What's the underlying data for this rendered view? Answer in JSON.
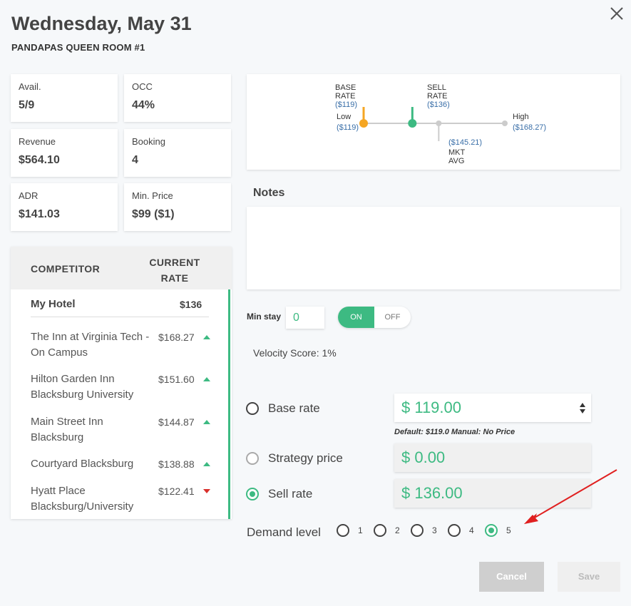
{
  "header": {
    "title": "Wednesday, May 31",
    "subtitle": "PANDAPAS QUEEN ROOM #1"
  },
  "stats": [
    {
      "label": "Avail.",
      "value": "5/9"
    },
    {
      "label": "OCC",
      "value": "44%"
    },
    {
      "label": "Revenue",
      "value": "$564.10"
    },
    {
      "label": "Booking",
      "value": "4"
    },
    {
      "label": "ADR",
      "value": "$141.03"
    },
    {
      "label": "Min. Price",
      "value": "$99 ($1)"
    }
  ],
  "competitors": {
    "col_competitor": "COMPETITOR",
    "col_rate_line1": "CURRENT",
    "col_rate_line2": "RATE",
    "my_hotel": {
      "name": "My Hotel",
      "rate": "$136"
    },
    "rows": [
      {
        "name": "The Inn at Virginia Tech - On Campus",
        "rate": "$168.27",
        "trend": "up"
      },
      {
        "name": "Hilton Garden Inn Blacksburg University",
        "rate": "$151.60",
        "trend": "up"
      },
      {
        "name": "Main Street Inn Blacksburg",
        "rate": "$144.87",
        "trend": "up"
      },
      {
        "name": "Courtyard Blacksburg",
        "rate": "$138.88",
        "trend": "up"
      },
      {
        "name": "Hyatt Place Blacksburg/University",
        "rate": "$122.41",
        "trend": "down"
      }
    ]
  },
  "rate_range": {
    "base_label_1": "BASE",
    "base_label_2": "RATE",
    "base_value": "($119)",
    "sell_label_1": "SELL",
    "sell_label_2": "RATE",
    "sell_value": "($136)",
    "low_label": "Low",
    "low_value": "($119)",
    "high_label": "High",
    "high_value": "($168.27)",
    "mkt_value": "($145.21)",
    "mkt_label_1": "MKT",
    "mkt_label_2": "AVG",
    "low": 119,
    "high": 168.27,
    "base": 119,
    "sell": 136,
    "mkt_avg": 145.21,
    "colors": {
      "base": "#f5a623",
      "sell": "#3dba82",
      "track": "#cccccc"
    }
  },
  "notes": {
    "label": "Notes",
    "value": ""
  },
  "min_stay": {
    "label": "Min stay",
    "value": "0"
  },
  "toggle": {
    "on_label": "ON",
    "off_label": "OFF",
    "state": "on"
  },
  "velocity": "Velocity Score: 1%",
  "pricing": {
    "base_rate_label": "Base rate",
    "base_rate_value": "$ 119.00",
    "default_note": "Default: $119.0   Manual: No Price",
    "strategy_label": "Strategy price",
    "strategy_value": "$ 0.00",
    "sell_label": "Sell rate",
    "sell_value": "$ 136.00",
    "selected": "sell"
  },
  "demand": {
    "label": "Demand level",
    "options": [
      "1",
      "2",
      "3",
      "4",
      "5"
    ],
    "selected": "5"
  },
  "buttons": {
    "cancel": "Cancel",
    "save": "Save"
  },
  "accent_color": "#3dba82",
  "annotation_color": "#e02020"
}
